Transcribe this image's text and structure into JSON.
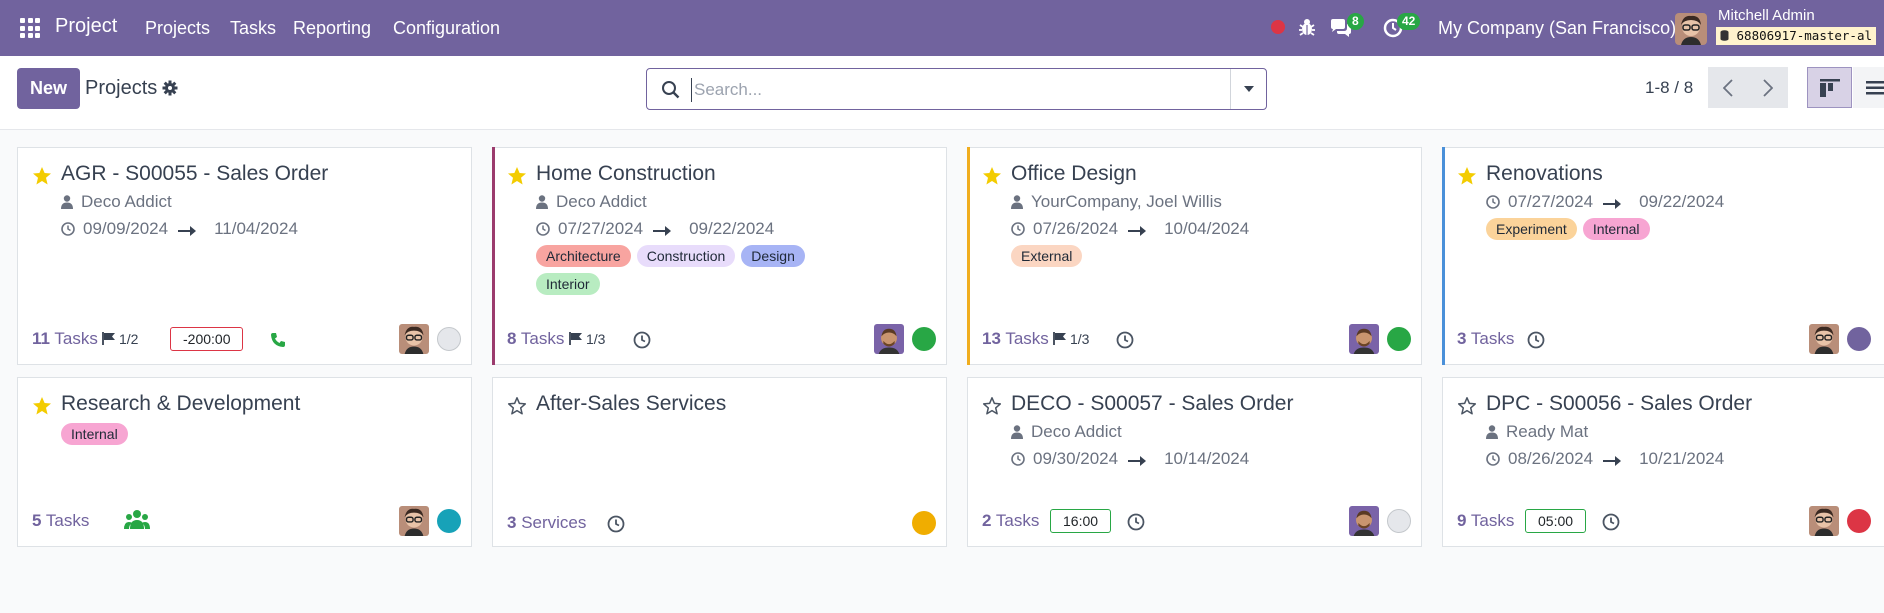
{
  "navbar": {
    "app_name": "Project",
    "menu": [
      "Projects",
      "Tasks",
      "Reporting",
      "Configuration"
    ],
    "messages_count": "8",
    "activities_count": "42",
    "company": "My Company (San Francisco)",
    "user_name": "Mitchell Admin",
    "database": "68806917-master-al",
    "icons": [
      "apps-icon",
      "record-icon",
      "bug-icon",
      "chat-icon",
      "clock-icon"
    ]
  },
  "control": {
    "new_label": "New",
    "breadcrumb": "Projects",
    "search_placeholder": "Search...",
    "pager": "1-8 / 8"
  },
  "colors": {
    "brand": "#71639e",
    "status_green": "#28a745",
    "status_red": "#dc3545"
  },
  "cards": [
    {
      "title": "AGR - S00055 - Sales Order",
      "favorite": true,
      "partner": "Deco Addict",
      "date_start": "09/09/2024",
      "date_end": "11/04/2024",
      "tasks_count": "11",
      "tasks_label": "Tasks",
      "milestones": "1/2",
      "allocated": "-200:00",
      "status": "none"
    },
    {
      "title": "Home Construction",
      "favorite": true,
      "partner": "Deco Addict",
      "date_start": "07/27/2024",
      "date_end": "09/22/2024",
      "tags": [
        {
          "name": "Architecture",
          "color": "#f8a4a0"
        },
        {
          "name": "Construction",
          "color": "#e8dcfb"
        },
        {
          "name": "Design",
          "color": "#a7b4f5"
        },
        {
          "name": "Interior",
          "color": "#b8ecc1"
        }
      ],
      "tasks_count": "8",
      "tasks_label": "Tasks",
      "milestones": "1/3",
      "status": "on-track"
    },
    {
      "title": "Office Design",
      "favorite": true,
      "partner": "YourCompany, Joel Willis",
      "date_start": "07/26/2024",
      "date_end": "10/04/2024",
      "tags": [
        {
          "name": "External",
          "color": "#fbd6c2"
        }
      ],
      "tasks_count": "13",
      "tasks_label": "Tasks",
      "milestones": "1/3",
      "status": "on-track"
    },
    {
      "title": "Renovations",
      "favorite": true,
      "date_start": "07/27/2024",
      "date_end": "09/22/2024",
      "tags": [
        {
          "name": "Experiment",
          "color": "#fbd39a"
        },
        {
          "name": "Internal",
          "color": "#f7a5d2"
        }
      ],
      "tasks_count": "3",
      "tasks_label": "Tasks",
      "status": "done"
    },
    {
      "title": "Research & Development",
      "favorite": true,
      "tags": [
        {
          "name": "Internal",
          "color": "#f7a5d2"
        }
      ],
      "tasks_count": "5",
      "tasks_label": "Tasks",
      "status": "info"
    },
    {
      "title": "After-Sales Services",
      "favorite": false,
      "tasks_count": "3",
      "tasks_label": "Services",
      "status": "at-risk"
    },
    {
      "title": "DECO - S00057 - Sales Order",
      "favorite": false,
      "partner": "Deco Addict",
      "date_start": "09/30/2024",
      "date_end": "10/14/2024",
      "tasks_count": "2",
      "tasks_label": "Tasks",
      "allocated": "16:00",
      "status": "none"
    },
    {
      "title": "DPC - S00056 - Sales Order",
      "favorite": false,
      "partner": "Ready Mat",
      "date_start": "08/26/2024",
      "date_end": "10/21/2024",
      "tasks_count": "9",
      "tasks_label": "Tasks",
      "allocated": "05:00",
      "status": "off-track"
    }
  ]
}
